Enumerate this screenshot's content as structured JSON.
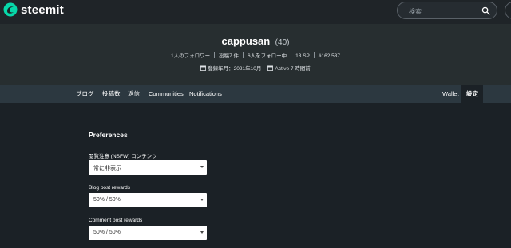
{
  "header": {
    "brand": "steemit",
    "search_placeholder": "検索"
  },
  "profile": {
    "username": "cappusan",
    "reputation": "(40)",
    "stats": [
      "1人のフォロワー",
      "投稿7 件",
      "6人をフォロー中",
      "13 SP",
      "#162,537"
    ],
    "joined": "登録年月：2021年10月",
    "active": "Active 7 時間前"
  },
  "tabs": {
    "blog": "ブログ",
    "posts": "投稿数",
    "replies": "返信",
    "communities": "Communities",
    "notifications": "Notifications",
    "wallet": "Wallet",
    "settings": "設定"
  },
  "preferences": {
    "title": "Preferences",
    "nsfw_label": "閲覧注意 (NSFW) コンテンツ",
    "nsfw_value": "常に非表示",
    "blog_rewards_label": "Blog post rewards",
    "blog_rewards_value": "50% / 50%",
    "comment_rewards_label": "Comment post rewards",
    "comment_rewards_value": "50% / 50%"
  },
  "colors": {
    "brand_accent": "#07d7a9",
    "background": "#1b2126",
    "banner": "#272e30",
    "tabbar": "#2c3840"
  }
}
